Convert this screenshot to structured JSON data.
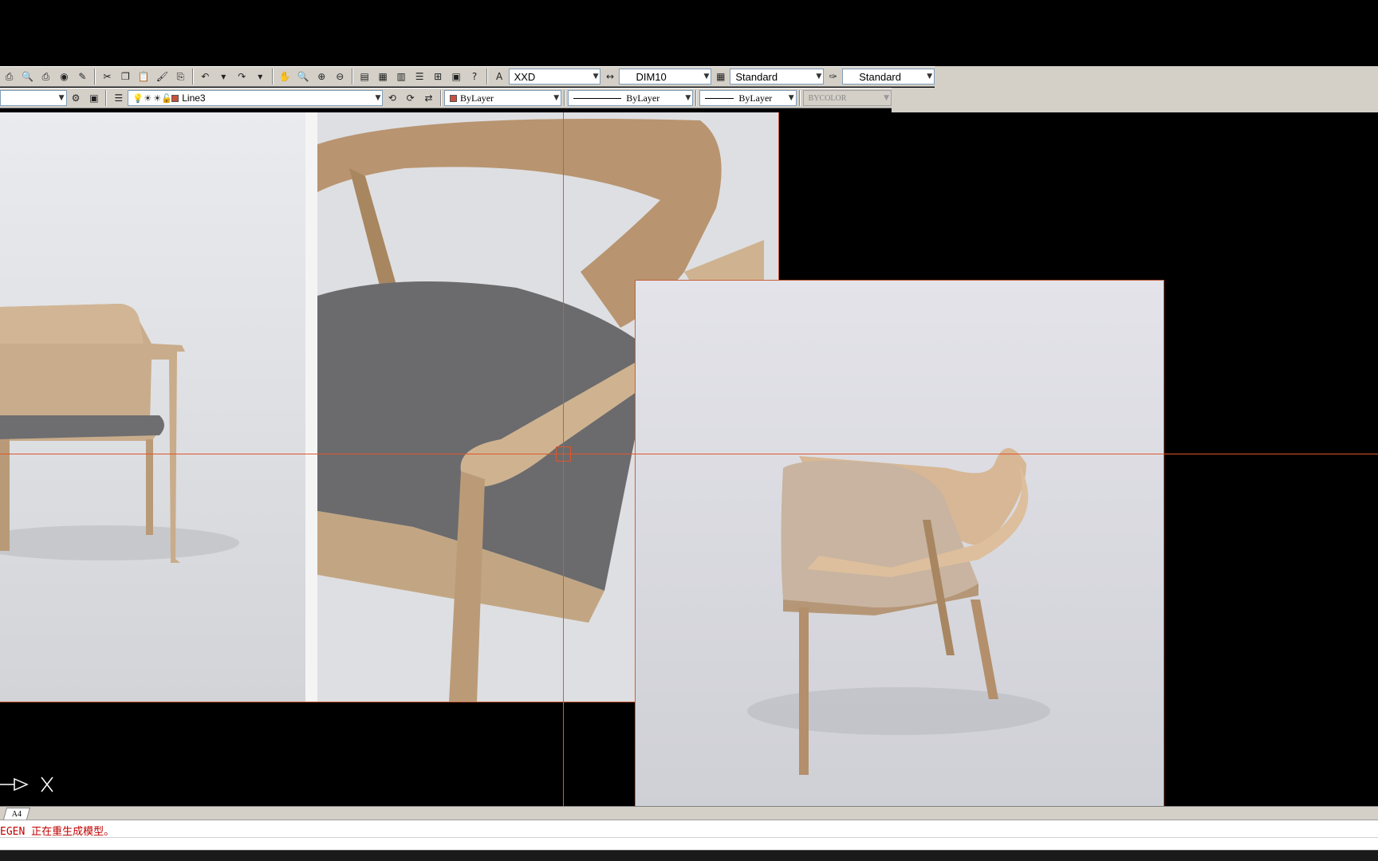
{
  "toolbar_standard": {
    "text_style": "XXD",
    "dim_style": "DIM10",
    "table_style": "Standard",
    "multileader_style": "Standard"
  },
  "toolbar_layers": {
    "layer_state": "",
    "current_layer": "Line3",
    "layer_color_hex": "#c8503c",
    "color_control": "ByLayer",
    "color_swatch_hex": "#c8503c",
    "linetype_control": "ByLayer",
    "lineweight_control": "ByLayer",
    "plotstyle_control": "BYCOLOR"
  },
  "tabs": {
    "layout_tab": "A4"
  },
  "command_line": {
    "history": "EGEN 正在重生成模型。"
  },
  "colors": {
    "crosshair": "#e0552a",
    "frame": "#c8603a",
    "background": "#000000",
    "command_text": "#c00000"
  },
  "icons": {
    "ucs": "ucs-arrow-icon",
    "x_marker": "ucs-x-icon"
  }
}
